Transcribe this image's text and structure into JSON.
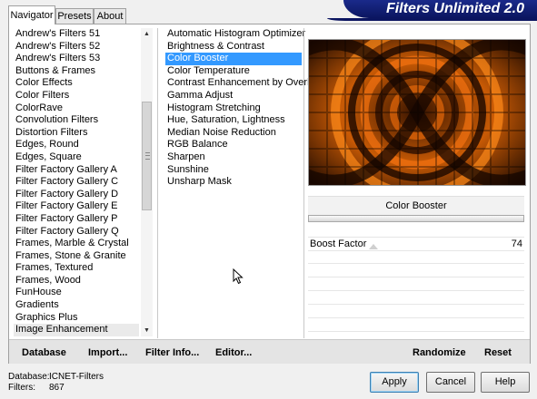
{
  "tabs": [
    "Navigator",
    "Presets",
    "About"
  ],
  "banner": {
    "title": "Filters Unlimited 2.0"
  },
  "categories": [
    "Andrew's Filters 51",
    "Andrew's Filters 52",
    "Andrew's Filters 53",
    "Buttons & Frames",
    "Color Effects",
    "Color Filters",
    "ColorRave",
    "Convolution Filters",
    "Distortion Filters",
    "Edges, Round",
    "Edges, Square",
    "Filter Factory Gallery A",
    "Filter Factory Gallery C",
    "Filter Factory Gallery D",
    "Filter Factory Gallery E",
    "Filter Factory Gallery P",
    "Filter Factory Gallery Q",
    "Frames, Marble & Crystal",
    "Frames, Stone & Granite",
    "Frames, Textured",
    "Frames, Wood",
    "FunHouse",
    "Gradients",
    "Graphics Plus",
    "Image Enhancement"
  ],
  "highlighted_category": "Image Enhancement",
  "filters": [
    "Automatic Histogram Optimizer",
    "Brightness & Contrast",
    "Color Booster",
    "Color Temperature",
    "Contrast Enhancement by Overlay",
    "Gamma Adjust",
    "Histogram Stretching",
    "Hue, Saturation, Lightness",
    "Median Noise Reduction",
    "RGB Balance",
    "Sharpen",
    "Sunshine",
    "Unsharp Mask"
  ],
  "selected_filter": "Color Booster",
  "filter_title": "Color Booster",
  "parameters": [
    {
      "name": "Boost Factor",
      "value": "74"
    }
  ],
  "toolbar": {
    "database": "Database",
    "import": "Import...",
    "filter_info": "Filter Info...",
    "editor": "Editor...",
    "randomize": "Randomize",
    "reset": "Reset"
  },
  "status": {
    "database_label": "Database:",
    "database_value": "ICNET-Filters",
    "filters_label": "Filters:",
    "filters_value": "867"
  },
  "buttons": {
    "apply": "Apply",
    "cancel": "Cancel",
    "help": "Help"
  },
  "colors": {
    "selection": "#3399ff",
    "banner": "#0b1560"
  }
}
